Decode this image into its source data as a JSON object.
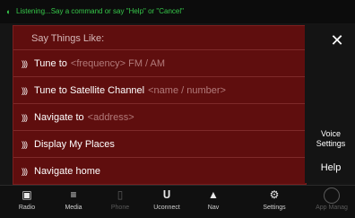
{
  "status": {
    "icon": "microphone-icon",
    "text": "Listening...Say a command or say \"Help\" or \"Cancel\""
  },
  "panel": {
    "header": "Say Things Like:",
    "commands": [
      {
        "label": "Tune to",
        "placeholder": "<frequency> FM / AM"
      },
      {
        "label": "Tune to Satellite Channel",
        "placeholder": "<name / number>"
      },
      {
        "label": "Navigate to",
        "placeholder": "<address>"
      },
      {
        "label": "Display My Places",
        "placeholder": ""
      },
      {
        "label": "Navigate home",
        "placeholder": ""
      }
    ]
  },
  "side": {
    "close_icon": "close-icon",
    "voice_settings_label": "Voice Settings",
    "help_label": "Help"
  },
  "nav": [
    {
      "label": "Radio",
      "icon": "radio-icon"
    },
    {
      "label": "Media",
      "icon": "media-icon"
    },
    {
      "label": "Phone",
      "icon": "phone-icon"
    },
    {
      "label": "Uconnect",
      "icon": "uconnect-icon"
    },
    {
      "label": "Nav",
      "icon": "nav-compass-icon"
    },
    {
      "label": "Settings",
      "icon": "settings-gear-icon"
    },
    {
      "label": "App Manag",
      "icon": "app-manager-icon"
    }
  ],
  "colors": {
    "panel": "#5f0e0e",
    "status_text": "#36c84a",
    "background": "#151515"
  }
}
